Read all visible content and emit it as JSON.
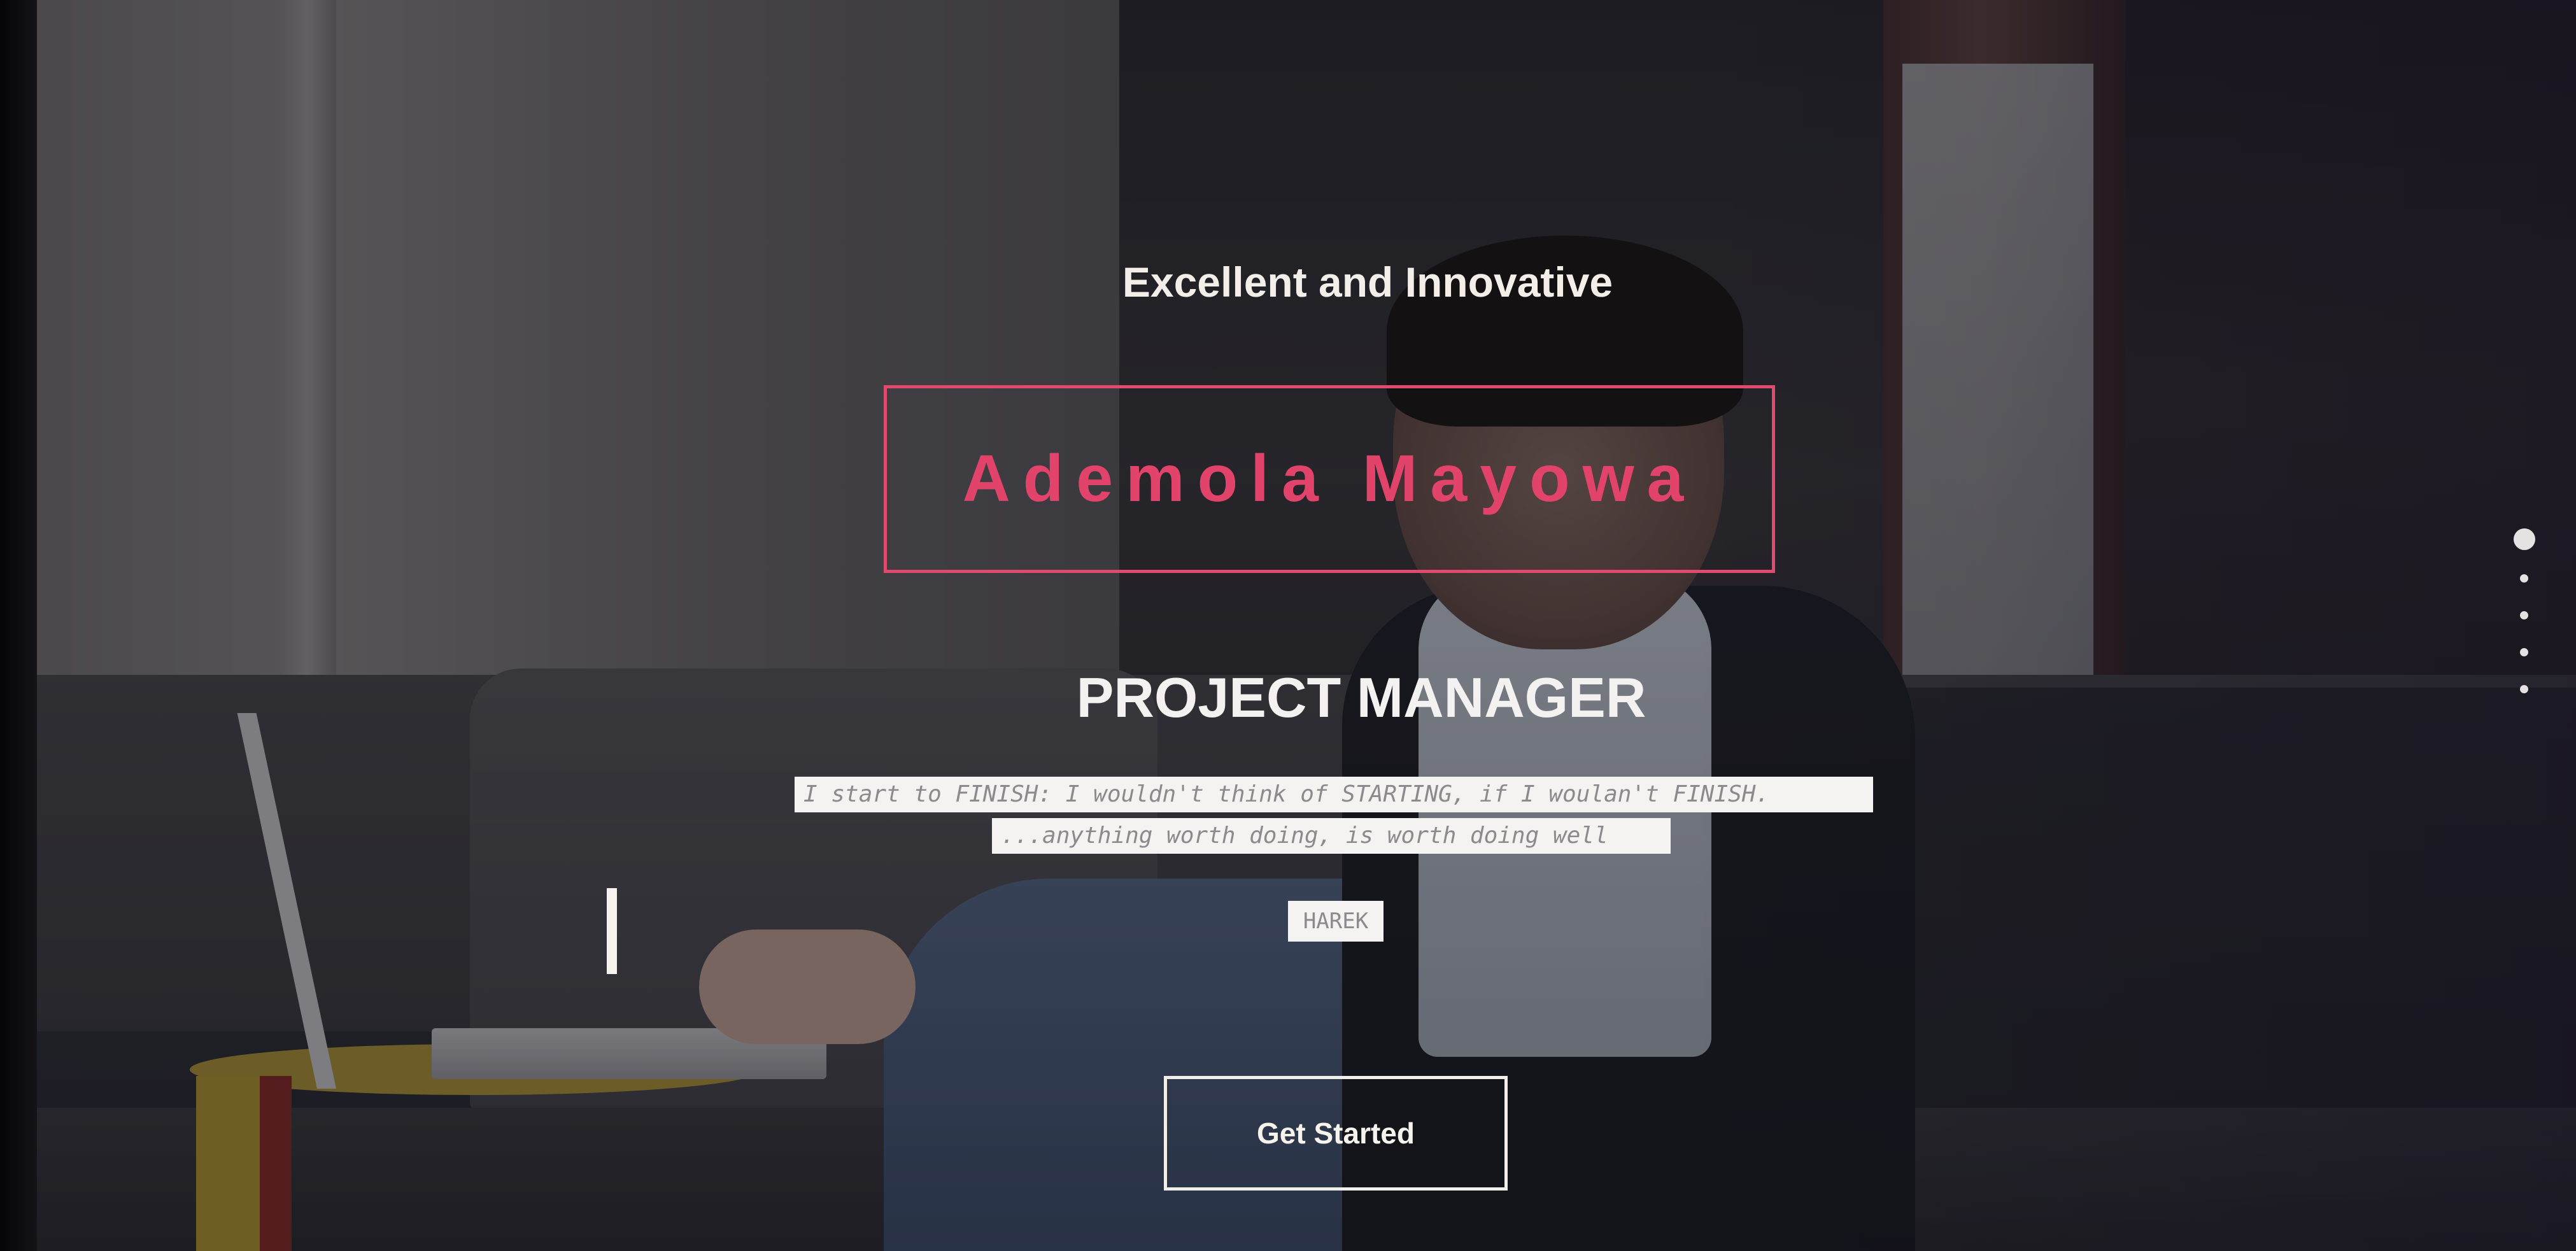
{
  "hero": {
    "tagline": "Excellent and Innovative",
    "name": "Ademola Mayowa",
    "role": "PROJECT MANAGER",
    "quote_lines": [
      "I start to FINISH: I wouldn't think of STARTING, if I woulan't FINISH.",
      "...anything worth doing, is worth doing well"
    ],
    "quote_author": "HAREK",
    "cta_label": "Get Started"
  },
  "slider": {
    "dot_count": 5,
    "active_index": 0
  },
  "colors": {
    "accent": "#e2436b",
    "text": "#f4f2f0",
    "quote_bg": "#f5f3f2",
    "quote_text": "#8c8a8c"
  }
}
